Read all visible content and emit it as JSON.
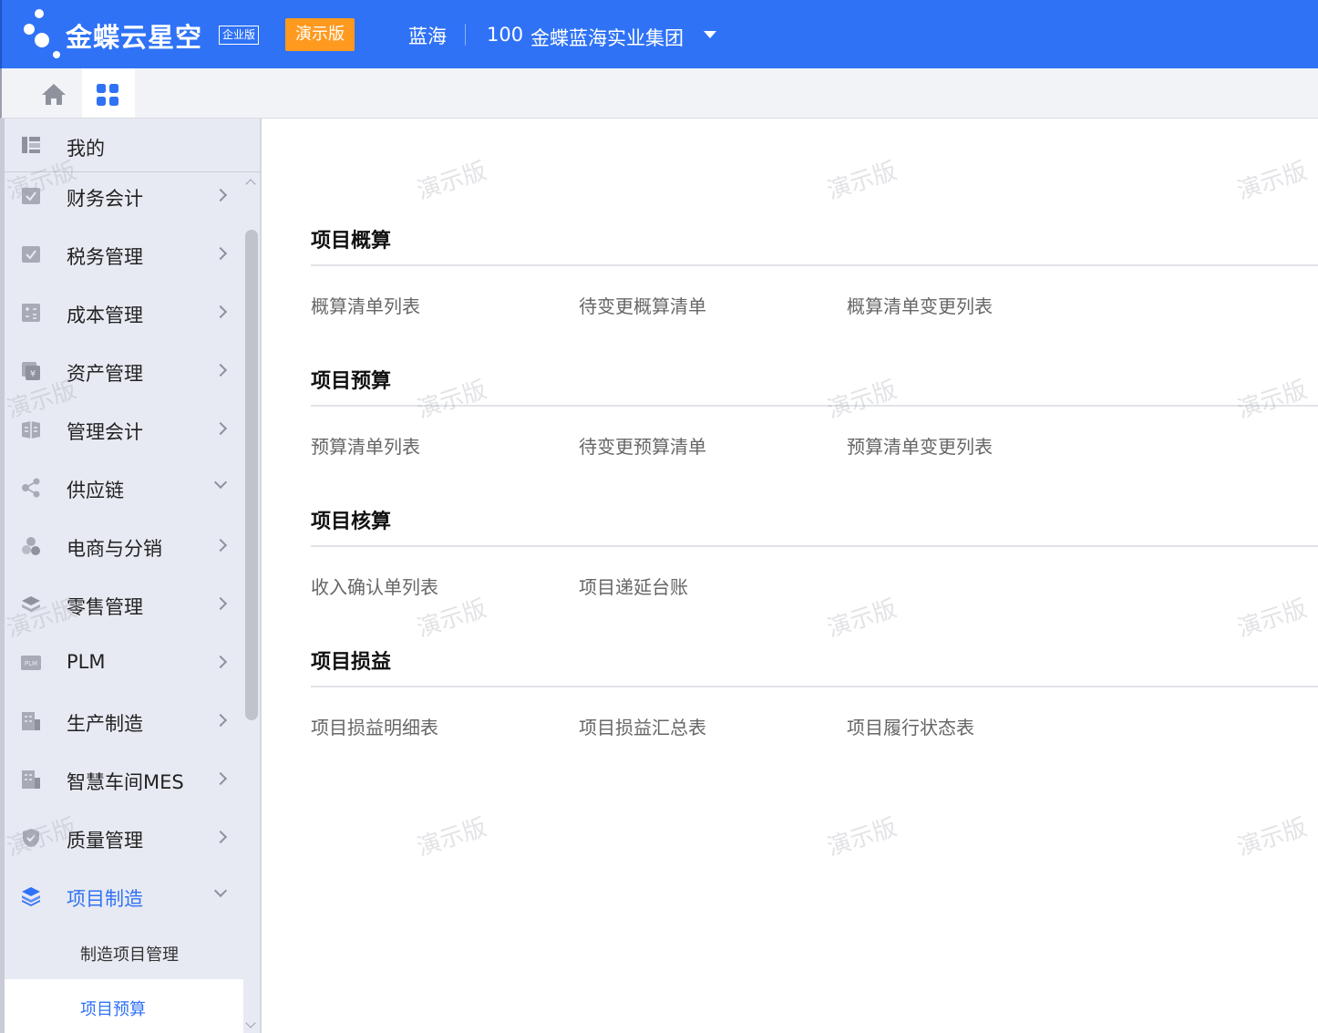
{
  "header": {
    "logo_text": "金蝶云星空",
    "edition": "企业版",
    "demo_badge": "演示版",
    "user": "蓝海",
    "org_id": "100",
    "org_name": "金蝶蓝海实业集团"
  },
  "tabs": [
    {
      "icon": "home-icon"
    },
    {
      "icon": "apps-grid-icon",
      "active": true
    }
  ],
  "sidebar": {
    "my_label": "我的",
    "items": [
      {
        "label": "财务会计",
        "icon": "finance-icon",
        "expand": "right"
      },
      {
        "label": "税务管理",
        "icon": "tax-icon",
        "expand": "right"
      },
      {
        "label": "成本管理",
        "icon": "cost-icon",
        "expand": "right"
      },
      {
        "label": "资产管理",
        "icon": "asset-icon",
        "expand": "right"
      },
      {
        "label": "管理会计",
        "icon": "management-accounting-icon",
        "expand": "right"
      },
      {
        "label": "供应链",
        "icon": "supply-chain-icon",
        "expand": "down"
      },
      {
        "label": "电商与分销",
        "icon": "ecommerce-icon",
        "expand": "right"
      },
      {
        "label": "零售管理",
        "icon": "retail-icon",
        "expand": "right"
      },
      {
        "label": "PLM",
        "icon": "plm-icon",
        "expand": "right"
      },
      {
        "label": "生产制造",
        "icon": "manufacturing-icon",
        "expand": "right"
      },
      {
        "label": "智慧车间MES",
        "icon": "mes-icon",
        "expand": "right"
      },
      {
        "label": "质量管理",
        "icon": "quality-icon",
        "expand": "right"
      },
      {
        "label": "项目制造",
        "icon": "project-layers-icon",
        "expand": "down",
        "active": true
      }
    ],
    "sub_items": [
      {
        "label": "制造项目管理"
      },
      {
        "label": "项目预算",
        "active": true
      }
    ]
  },
  "watermark": "演示版",
  "sections": [
    {
      "title": "项目概算",
      "links": [
        "概算清单列表",
        "待变更概算清单",
        "概算清单变更列表"
      ]
    },
    {
      "title": "项目预算",
      "links": [
        "预算清单列表",
        "待变更预算清单",
        "预算清单变更列表"
      ]
    },
    {
      "title": "项目核算",
      "links": [
        "收入确认单列表",
        "项目递延台账"
      ]
    },
    {
      "title": "项目损益",
      "links": [
        "项目损益明细表",
        "项目损益汇总表",
        "项目履行状态表"
      ]
    }
  ],
  "colors": {
    "header_bg": "#2f72f6",
    "demo_badge_bg": "#ff9a1f",
    "sidebar_bg": "#e8eaf3",
    "active_text": "#2f72f6"
  }
}
